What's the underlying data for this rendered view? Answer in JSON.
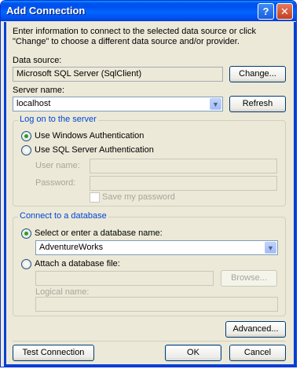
{
  "title": "Add Connection",
  "titlebar": {
    "help": "?",
    "close": "✕"
  },
  "intro": "Enter information to connect to the selected data source or click \"Change\" to choose a different data source and/or provider.",
  "data_source": {
    "label": "Data source:",
    "value": "Microsoft SQL Server (SqlClient)",
    "change_button": "Change..."
  },
  "server": {
    "label": "Server name:",
    "value": "localhost",
    "refresh_button": "Refresh"
  },
  "logon": {
    "group_title": "Log on to the server",
    "windows_auth": "Use Windows Authentication",
    "sql_auth": "Use SQL Server Authentication",
    "selected": "windows",
    "user_label": "User name:",
    "password_label": "Password:",
    "save_password": "Save my password"
  },
  "database": {
    "group_title": "Connect to a database",
    "select_label": "Select or enter a database name:",
    "selected_db": "AdventureWorks",
    "attach_label": "Attach a database file:",
    "browse_button": "Browse...",
    "logical_label": "Logical name:"
  },
  "buttons": {
    "advanced": "Advanced...",
    "test": "Test Connection",
    "ok": "OK",
    "cancel": "Cancel"
  }
}
